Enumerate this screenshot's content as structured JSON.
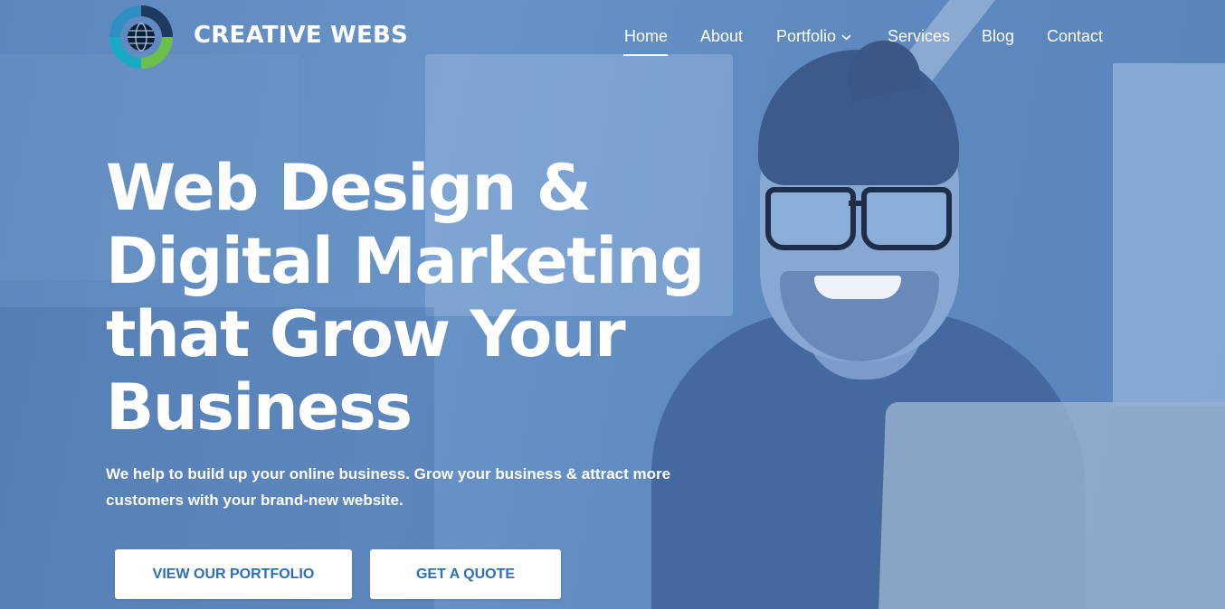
{
  "brand": {
    "name": "CREATIVE WEBS",
    "logo_icon": "globe-swirl-logo"
  },
  "nav": {
    "items": [
      {
        "label": "Home",
        "active": true
      },
      {
        "label": "About"
      },
      {
        "label": "Portfolio",
        "icon": "chevron-down-icon"
      },
      {
        "label": "Services"
      },
      {
        "label": "Blog"
      },
      {
        "label": "Contact"
      }
    ]
  },
  "hero": {
    "headline": "Web Design & Digital Marketing that Grow Your Business",
    "subtext": "We help to build up your online business. Grow your business & attract more customers with your brand-new website.",
    "buttons": {
      "portfolio": "VIEW OUR PORTFOLIO",
      "quote": "GET A QUOTE"
    }
  },
  "colors": {
    "overlay": "#5c87bd",
    "text": "#ffffff",
    "button_bg": "#ffffff",
    "button_text": "#2a70b8",
    "logo_teal": "#1aa9c4",
    "logo_green": "#6cc04a",
    "logo_navy": "#1d3a5f"
  }
}
